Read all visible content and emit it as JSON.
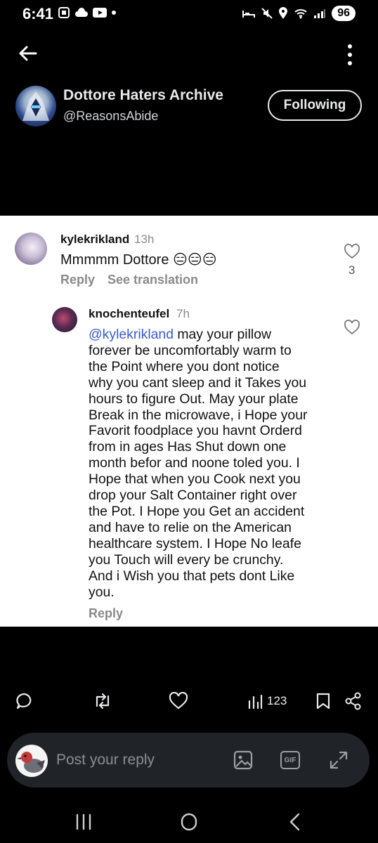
{
  "status_bar": {
    "time": "6:41",
    "battery": "96",
    "network": "5"
  },
  "header": {
    "account_name": "Dottore Haters Archive",
    "account_handle": "@ReasonsAbide",
    "follow_label": "Following"
  },
  "comments": [
    {
      "username": "kylekrikland",
      "time": "13h",
      "text": "Mmmmm Dottore 😑😑😑",
      "reply_label": "Reply",
      "translate_label": "See translation",
      "likes": "3"
    },
    {
      "username": "knochenteufel",
      "time": "7h",
      "mention": "@kylekrikland",
      "text": " may your pillow\nforever be uncomfortably warm to\nthe Point where you dont notice\nwhy you cant sleep and it Takes you\nhours to figure Out. May your plate\nBreak in the microwave, i Hope your\nFavorit foodplace you havnt Orderd\nfrom in ages Has Shut down one\nmonth befor and noone toled you. I\nHope that when you Cook next you\ndrop your Salt Container right over\nthe Pot. I Hope you Get an accident\nand have to relie on the American\nhealthcare system. I Hope No leafe\nyou Touch will every be crunchy.\nAnd i Wish you that pets dont Like\nyou.",
      "reply_label": "Reply"
    }
  ],
  "actions": {
    "views": "123"
  },
  "composer": {
    "placeholder": "Post your reply",
    "gif_label": "GIF"
  },
  "colors": {
    "background": "#000000",
    "panel": "#ffffff",
    "mention": "#3a5bd9",
    "composer_bg": "#202327"
  }
}
